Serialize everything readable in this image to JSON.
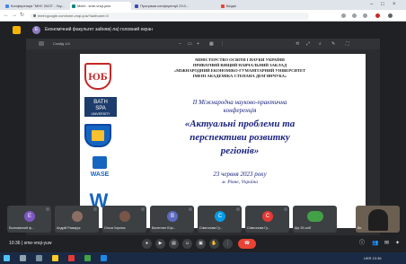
{
  "browser": {
    "tabs": [
      {
        "label": "Конференція \"МНУ 2023\" - Уку...",
        "color": "#4285f4"
      },
      {
        "label": "Meet - sme-vnqi-yuw",
        "color": "#00897b"
      },
      {
        "label": "Програма конференції 23.0...",
        "color": "#3949ab"
      },
      {
        "label": "Вхідні",
        "color": "#ea4335"
      }
    ],
    "url": "meet.google.com/sme-vnqi-yuw?authuser=0"
  },
  "meet": {
    "header_avatar": "Е",
    "header_title": "Економічний факультет зайняв(-ла) головний екран"
  },
  "presentation": {
    "file_name": "Слайд 1/4",
    "ministry_lines": [
      "МІНІСТЕРСТВО ОСВІТИ І НАУКИ УКРАЇНИ",
      "ПРИВАТНИЙ ВИЩИЙ НАВЧАЛЬНИЙ ЗАКЛАД",
      "«МІЖНАРОДНИЙ ЕКОНОМІКО-ГУМАНІТАРНИЙ УНІВЕРСИТЕТ",
      "ІМЕНІ АКАДЕМІКА СТЕПАНА ДЕМ'ЯНЧУКА»"
    ],
    "conference_line1": "II Міжнародна науково-практична",
    "conference_line2": "конференція",
    "title_line1": "«Актуальні проблеми та",
    "title_line2": "перспективи розвитку",
    "title_line3": "регіонів»",
    "date": "23 червня 2023 року",
    "city": "м. Рівне, Україна",
    "logo_bath_line1": "BATH",
    "logo_bath_line2": "SPA",
    "logo_bath_line3": "UNIVERSITY",
    "logo_wase": "WASE",
    "logo_red": "ЮБ",
    "logo_w": "W"
  },
  "participants": [
    {
      "initial": "Е",
      "name": "Економічний ф...",
      "color": "#7e57c2"
    },
    {
      "initial": "А",
      "name": "Андрій Римарук",
      "color": "#8d6e63"
    },
    {
      "initial": "О",
      "name": "Ольга Чорнюк",
      "color": "#795548"
    },
    {
      "initial": "В",
      "name": "Валентин Юрі...",
      "color": "#5c6bc0"
    },
    {
      "initial": "С",
      "name": "Співголова Гу...",
      "color": "#039be5"
    },
    {
      "initial": "С",
      "name": "Співголова Гу...",
      "color": "#e53935"
    },
    {
      "initial": "",
      "name": "Ще 25 осіб",
      "color": "#43a047"
    },
    {
      "initial": "",
      "name": "Ви",
      "color": "#6b5f52"
    }
  ],
  "controls": {
    "meeting_info": "10:36 | sme-vnqi-yuw",
    "buttons": [
      "mic",
      "cam",
      "cc",
      "emoji",
      "present",
      "raise",
      "more",
      "end"
    ]
  },
  "taskbar": {
    "tray": "UKR  10:36"
  }
}
